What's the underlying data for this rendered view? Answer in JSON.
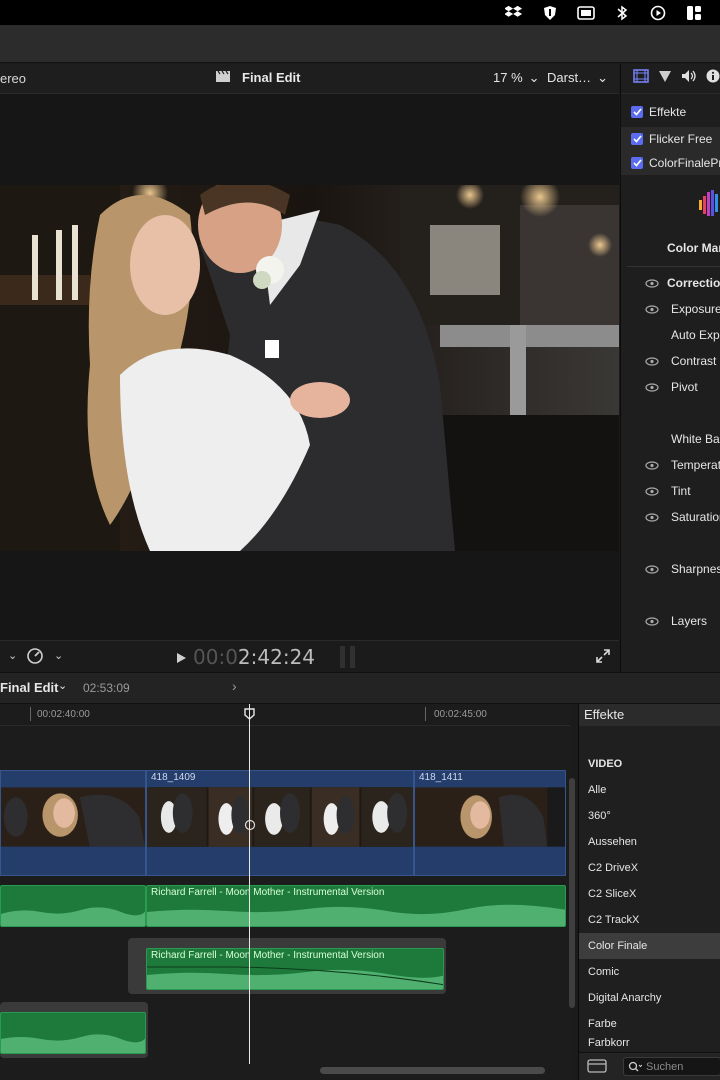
{
  "viewer": {
    "audio_label": "ereo",
    "project_title": "Final Edit",
    "zoom": "17 %",
    "view_menu": "Darst…",
    "timecode_dim": "00:0",
    "timecode_lit": "2:42:24"
  },
  "inspector": {
    "effects_label": "Effekte",
    "effect_1": "Flicker Free",
    "effect_2": "ColorFinalePro",
    "color_mark": "Color Mark",
    "rows": {
      "correction": "Correction",
      "exposure": "Exposure",
      "auto_exp": "Auto Exp",
      "contrast": "Contrast",
      "pivot": "Pivot",
      "white_bal": "White Bal",
      "temperature": "Temperatu",
      "tint": "Tint",
      "saturation": "Saturation",
      "sharpness": "Sharpness",
      "layers": "Layers"
    }
  },
  "timeline": {
    "project": "Final Edit",
    "duration": "02:53:09",
    "ruler": [
      "00:02:40:00",
      "00:02:45:00"
    ],
    "clips": [
      "418_1409",
      "418_1411"
    ],
    "audio_1": "Richard Farrell - Moon Mother - Instrumental Version",
    "audio_2": "Richard Farrell - Moon Mother - Instrumental Version"
  },
  "effects_browser": {
    "title": "Effekte",
    "header": "VIDEO",
    "items": [
      "Alle",
      "360°",
      "Aussehen",
      "C2 DriveX",
      "C2 SliceX",
      "C2 TrackX",
      "Color Finale",
      "Comic",
      "Digital Anarchy",
      "Farbe",
      "Farbkorr"
    ],
    "search_placeholder": "Suchen"
  },
  "colors": {
    "accent": "#5b6cf0",
    "video_clip": "#253d6b",
    "audio_clip": "#1d7a3b"
  }
}
